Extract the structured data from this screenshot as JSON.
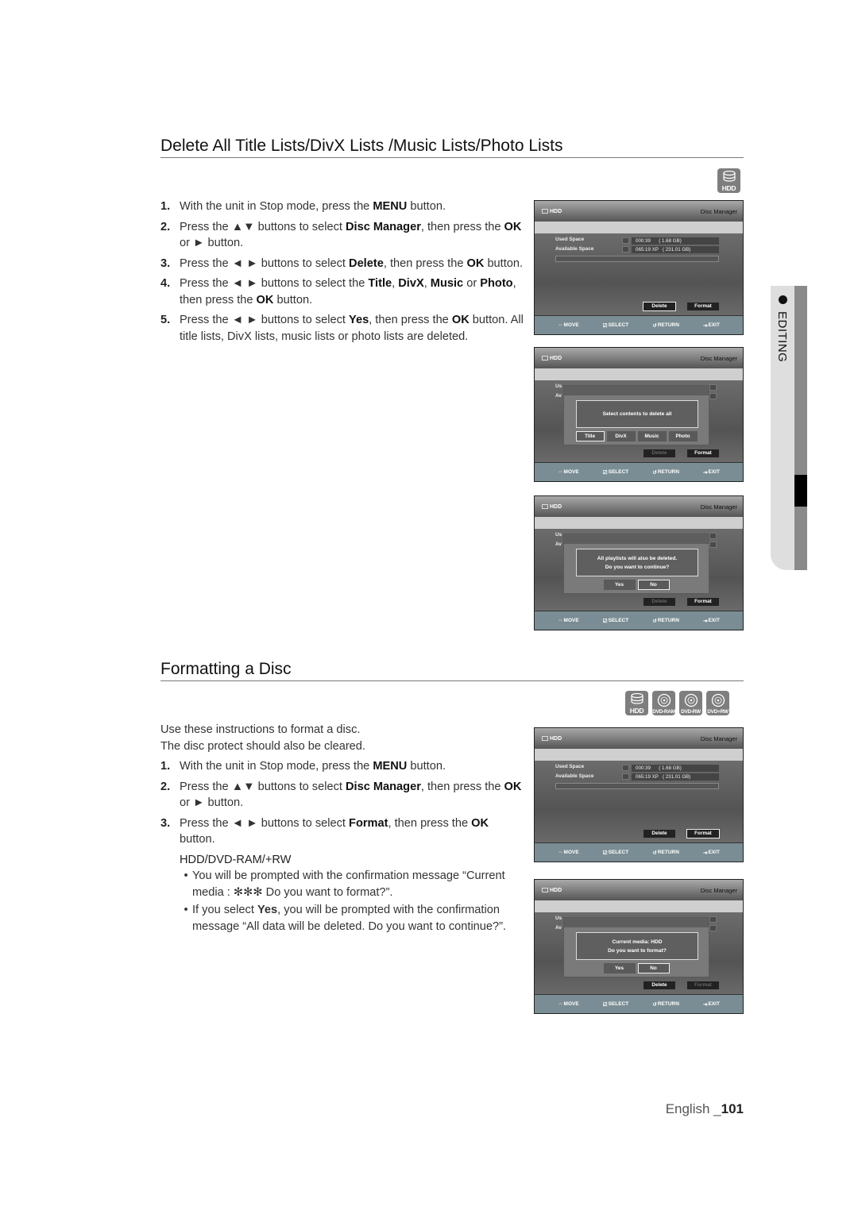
{
  "section1": {
    "title": "Delete All Title Lists/DivX Lists /Music Lists/Photo Lists",
    "media_icons": [
      {
        "icon": "hdd-icon",
        "label": "HDD"
      }
    ],
    "steps": [
      {
        "num": "1.",
        "parts": [
          "With the unit in Stop mode, press the ",
          {
            "b": "MENU"
          },
          " button."
        ]
      },
      {
        "num": "2.",
        "parts": [
          "Press the ▲▼ buttons to select ",
          {
            "b": "Disc Manager"
          },
          ", then press the ",
          {
            "b": "OK"
          },
          " or ► button."
        ]
      },
      {
        "num": "3.",
        "parts": [
          "Press the ◄ ► buttons to select ",
          {
            "b": "Delete"
          },
          ", then press the ",
          {
            "b": "OK"
          },
          " button."
        ]
      },
      {
        "num": "4.",
        "parts": [
          "Press the ◄ ► buttons to select the ",
          {
            "b": "Title"
          },
          ", ",
          {
            "b": "DivX"
          },
          ", ",
          {
            "b": "Music"
          },
          " or ",
          {
            "b": "Photo"
          },
          ", then press the ",
          {
            "b": "OK"
          },
          " button."
        ]
      },
      {
        "num": "5.",
        "parts": [
          "Press the ◄ ► buttons to select ",
          {
            "b": "Yes"
          },
          ", then press the ",
          {
            "b": "OK"
          },
          " button. All title lists, DivX lists, music lists or photo lists are deleted."
        ]
      }
    ]
  },
  "section2": {
    "title": "Formatting a Disc",
    "media_icons": [
      {
        "icon": "hdd-icon",
        "label": "HDD"
      },
      {
        "icon": "dvd-ram-icon",
        "label": "DVD-RAM"
      },
      {
        "icon": "dvd-rw-icon",
        "label": "DVD-RW"
      },
      {
        "icon": "dvd-plus-rw-icon",
        "label": "DVD+RW"
      }
    ],
    "intro": [
      "Use these instructions to format a disc.",
      "The disc protect should also be cleared."
    ],
    "steps": [
      {
        "num": "1.",
        "parts": [
          "With the unit in Stop mode, press the ",
          {
            "b": "MENU"
          },
          " button."
        ]
      },
      {
        "num": "2.",
        "parts": [
          "Press the ▲▼ buttons to select ",
          {
            "b": "Disc Manager"
          },
          ", then press the ",
          {
            "b": "OK"
          },
          " or ► button."
        ]
      },
      {
        "num": "3.",
        "parts": [
          "Press the ◄ ► buttons to select ",
          {
            "b": "Format"
          },
          ", then press the ",
          {
            "b": "OK"
          },
          " button."
        ]
      }
    ],
    "subhead": "HDD/DVD-RAM/+RW",
    "bullets": [
      {
        "parts": [
          "You will be prompted with the confirmation message “Current media : ✻✻✻ Do you want to format?”."
        ]
      },
      {
        "parts": [
          "If you select ",
          {
            "b": "Yes"
          },
          ", you will be prompted with the confirmation message “All data will be deleted. Do you want to continue?”."
        ]
      }
    ]
  },
  "screen": {
    "source": "HDD",
    "title": "Disc Manager",
    "used_label": "Used Space",
    "avail_label": "Available Space",
    "used_value": "000:39      ( 1.68 GB)",
    "avail_value": "065:19 XP   ( 231.01 GB)",
    "used_short": "Us",
    "avail_short": "Av",
    "delete": "Delete",
    "format": "Format",
    "footer": {
      "move": "MOVE",
      "select": "SELECT",
      "return": "RETURN",
      "exit": "EXIT"
    },
    "popup_select": {
      "message": "Select contents to delete all",
      "options": [
        "Title",
        "DivX",
        "Music",
        "Photo"
      ]
    },
    "popup_delete": {
      "line1": "All playlists will also be deleted.",
      "line2": "Do you want to continue?"
    },
    "popup_format": {
      "line1": "Current media: HDD",
      "line2": "Do you want to format?"
    },
    "yes": "Yes",
    "no": "No"
  },
  "side_tab": {
    "label": "EDITING"
  },
  "footer": {
    "language": "English _",
    "page": "101"
  }
}
